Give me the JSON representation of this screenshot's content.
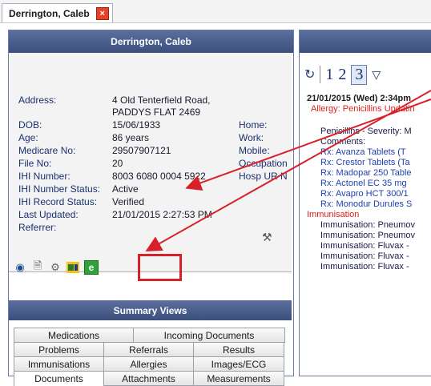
{
  "patient_tab": {
    "name": "Derrington, Caleb",
    "close": "×"
  },
  "left_panel": {
    "title": "Derrington, Caleb"
  },
  "demographics": {
    "address_label": "Address:",
    "address_line1": "4 Old Tenterfield Road,",
    "address_line2": "PADDYS FLAT  2469",
    "dob_label": "DOB:",
    "dob": "15/06/1933",
    "age_label": "Age:",
    "age": "86 years",
    "medicare_label": "Medicare No:",
    "medicare": "29507907121",
    "file_label": "File No:",
    "file": "20",
    "ihi_label": "IHI Number:",
    "ihi": "8003 6080 0004 5922",
    "ihi_status_label": "IHI Number Status:",
    "ihi_status": "Active",
    "ihi_record_label": "IHI Record Status:",
    "ihi_record": "Verified",
    "last_updated_label": "Last Updated:",
    "last_updated": "21/01/2015 2:27:53 PM",
    "referrer_label": "Referrer:",
    "home_label": "Home:",
    "work_label": "Work:",
    "mobile_label": "Mobile:",
    "occupation_label": "Occupation",
    "hosp_label": "Hosp UR N"
  },
  "icons": {
    "view": "eye-icon",
    "doc": "document-icon",
    "wrench": "tools-icon",
    "card": "card-icon",
    "ehealth": "e-icon",
    "ehealth_letter": "e"
  },
  "summary_views": {
    "title": "Summary Views",
    "row1": [
      "Medications",
      "Incoming Documents"
    ],
    "row2": [
      "Problems",
      "Referrals",
      "Results"
    ],
    "row3": [
      "Immunisations",
      "Allergies",
      "Images/ECG"
    ],
    "row4": [
      "Documents",
      "Attachments",
      "Measurements"
    ]
  },
  "toolbar": {
    "page1": "1",
    "page2": "2",
    "page3": "3"
  },
  "notes": {
    "date": "21/01/2015 (Wed) 2:34pm",
    "allergy": "Allergy: Penicillins Updatin",
    "penicillins": "Penicillins - Severity: M",
    "comments": "Comments:",
    "rx1": "Rx: Avanza Tablets (T",
    "rx2": "Rx: Crestor Tablets (Ta",
    "rx3": "Rx: Madopar 250 Table",
    "rx4": "Rx: Actonel EC 35 mg",
    "rx5": "Rx: Avapro HCT 300/1",
    "rx6": "Rx: Monodur Durules S",
    "immunisation": "Immunisation",
    "im1": "Immunisation: Pneumov",
    "im2": "Immunisation: Pneumov",
    "im3": "Immunisation: Fluvax -",
    "im4": "Immunisation: Fluvax -",
    "im5": "Immunisation: Fluvax -"
  },
  "colors": {
    "header": "#4a5d8c",
    "highlight": "#d8202a",
    "allergy": "#e0201a",
    "rx": "#2040b0"
  }
}
